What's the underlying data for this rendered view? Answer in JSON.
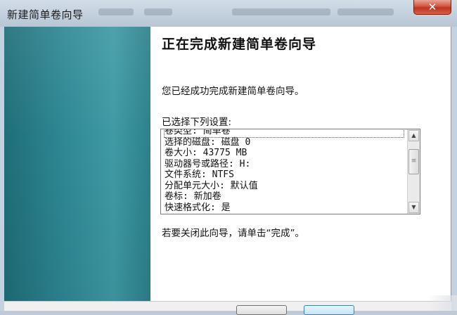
{
  "window": {
    "title": "新建简单卷向导",
    "close_label": "✕"
  },
  "wizard": {
    "heading": "正在完成新建简单卷向导",
    "success_message": "您已经成功完成新建简单卷向导。",
    "settings_label": "已选择下列设置:",
    "settings": [
      "卷类型: 简单卷",
      "选择的磁盘: 磁盘 0",
      "卷大小: 43775 MB",
      "驱动器号或路径: H:",
      "文件系统: NTFS",
      "分配单元大小: 默认值",
      "卷标: 新加卷",
      "快速格式化: 是"
    ],
    "close_instruction": "若要关闭此向导，请单击“完成”。"
  },
  "colors": {
    "sidebar_accent": "#2e8794",
    "close_button": "#c2321e"
  }
}
